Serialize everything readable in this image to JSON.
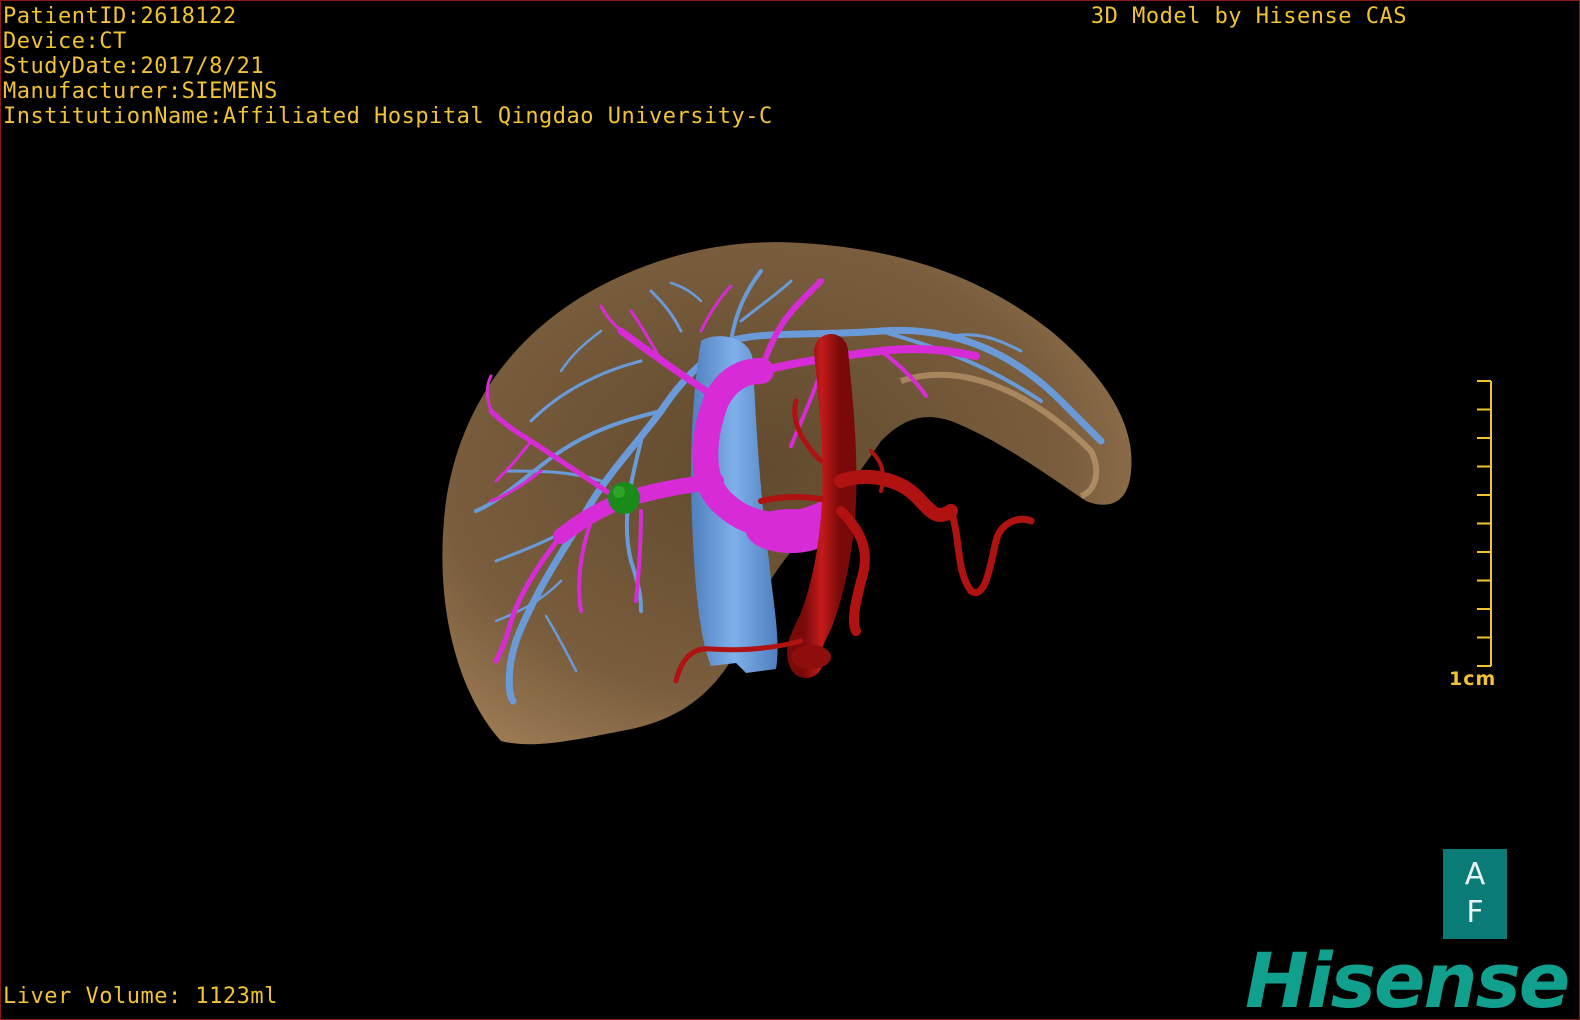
{
  "overlay": {
    "patient_id": "PatientID:2618122",
    "device": "Device:CT",
    "study_date": "StudyDate:2017/8/21",
    "manufacturer": "Manufacturer:SIEMENS",
    "institution": "InstitutionName:Affiliated Hospital Qingdao University-C",
    "brand_caption": "3D Model by Hisense CAS",
    "liver_volume": "Liver Volume: 1123ml"
  },
  "scale_bar": {
    "label": "1cm",
    "ticks": 10
  },
  "orientation_cube": {
    "top_label": "A",
    "bottom_label": "F"
  },
  "logo": {
    "text": "Hisense"
  },
  "model": {
    "structures": [
      "liver",
      "hepatic-veins",
      "portal-vein",
      "inferior-vena-cava",
      "hepatic-artery",
      "lesion"
    ]
  },
  "colors": {
    "overlay_text": "#f1c232",
    "liver": "#8a6a46",
    "hepatic_veins": "#6a9bd8",
    "portal_vein": "#d82bd8",
    "artery": "#b01212",
    "lesion": "#1a8a1a",
    "logo": "#11a08e",
    "orientation_cube": "#0b7b77",
    "viewport_border": "#8a1a1a"
  }
}
